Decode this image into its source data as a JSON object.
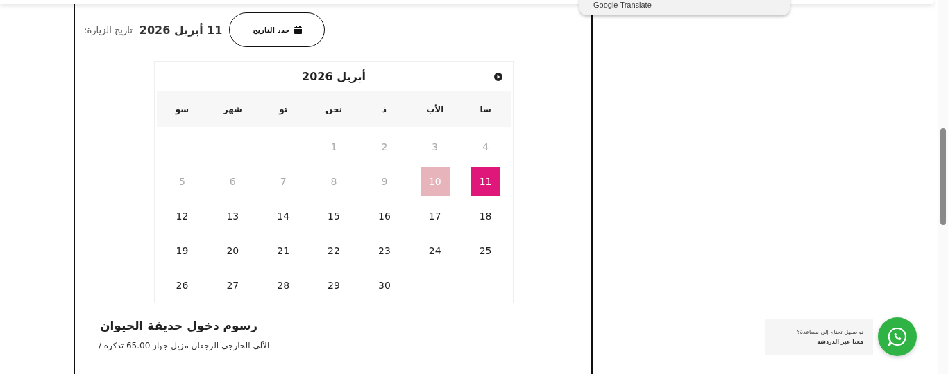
{
  "translate_popup": {
    "label": "Google Translate"
  },
  "visit_date": {
    "button": "حدد التاريخ",
    "value": "11 أبريل 2026",
    "label": "تاريخ الزيارة:"
  },
  "calendar": {
    "title": "أبريل 2026",
    "weekdays": [
      "سا",
      "الأب",
      "ذ",
      "نحن",
      "تو",
      "شهر",
      "سو"
    ],
    "days": [
      {
        "kind": "day",
        "text": "4",
        "disabled": true,
        "selected": false,
        "today": false
      },
      {
        "kind": "day",
        "text": "3",
        "disabled": true,
        "selected": false,
        "today": false
      },
      {
        "kind": "day",
        "text": "2",
        "disabled": true,
        "selected": false,
        "today": false
      },
      {
        "kind": "day",
        "text": "1",
        "disabled": true,
        "selected": false,
        "today": false
      },
      {
        "kind": "blank"
      },
      {
        "kind": "blank"
      },
      {
        "kind": "blank"
      },
      {
        "kind": "day",
        "text": "11",
        "disabled": false,
        "selected": true,
        "today": false
      },
      {
        "kind": "day",
        "text": "10",
        "disabled": true,
        "selected": false,
        "today": true
      },
      {
        "kind": "day",
        "text": "9",
        "disabled": true,
        "selected": false,
        "today": false
      },
      {
        "kind": "day",
        "text": "8",
        "disabled": true,
        "selected": false,
        "today": false
      },
      {
        "kind": "day",
        "text": "7",
        "disabled": true,
        "selected": false,
        "today": false
      },
      {
        "kind": "day",
        "text": "6",
        "disabled": true,
        "selected": false,
        "today": false
      },
      {
        "kind": "day",
        "text": "5",
        "disabled": true,
        "selected": false,
        "today": false
      },
      {
        "kind": "day",
        "text": "18",
        "disabled": false,
        "selected": false,
        "today": false
      },
      {
        "kind": "day",
        "text": "17",
        "disabled": false,
        "selected": false,
        "today": false
      },
      {
        "kind": "day",
        "text": "16",
        "disabled": false,
        "selected": false,
        "today": false
      },
      {
        "kind": "day",
        "text": "15",
        "disabled": false,
        "selected": false,
        "today": false
      },
      {
        "kind": "day",
        "text": "14",
        "disabled": false,
        "selected": false,
        "today": false
      },
      {
        "kind": "day",
        "text": "13",
        "disabled": false,
        "selected": false,
        "today": false
      },
      {
        "kind": "day",
        "text": "12",
        "disabled": false,
        "selected": false,
        "today": false
      },
      {
        "kind": "day",
        "text": "25",
        "disabled": false,
        "selected": false,
        "today": false
      },
      {
        "kind": "day",
        "text": "24",
        "disabled": false,
        "selected": false,
        "today": false
      },
      {
        "kind": "day",
        "text": "23",
        "disabled": false,
        "selected": false,
        "today": false
      },
      {
        "kind": "day",
        "text": "22",
        "disabled": false,
        "selected": false,
        "today": false
      },
      {
        "kind": "day",
        "text": "21",
        "disabled": false,
        "selected": false,
        "today": false
      },
      {
        "kind": "day",
        "text": "20",
        "disabled": false,
        "selected": false,
        "today": false
      },
      {
        "kind": "day",
        "text": "19",
        "disabled": false,
        "selected": false,
        "today": false
      },
      {
        "kind": "blank"
      },
      {
        "kind": "blank"
      },
      {
        "kind": "day",
        "text": "30",
        "disabled": false,
        "selected": false,
        "today": false
      },
      {
        "kind": "day",
        "text": "29",
        "disabled": false,
        "selected": false,
        "today": false
      },
      {
        "kind": "day",
        "text": "28",
        "disabled": false,
        "selected": false,
        "today": false
      },
      {
        "kind": "day",
        "text": "27",
        "disabled": false,
        "selected": false,
        "today": false
      },
      {
        "kind": "day",
        "text": "26",
        "disabled": false,
        "selected": false,
        "today": false
      }
    ]
  },
  "fees": {
    "heading": "رسوم دخول حديقة الحيوان",
    "line": "الآلي الخارجي الرجفان مزيل جهاز 65.00 تذكرة /"
  },
  "chat": {
    "line_1": "تواصلهل تحتاج إلى مساعدة؟",
    "line_2": "معنا عبر الدردشة"
  }
}
